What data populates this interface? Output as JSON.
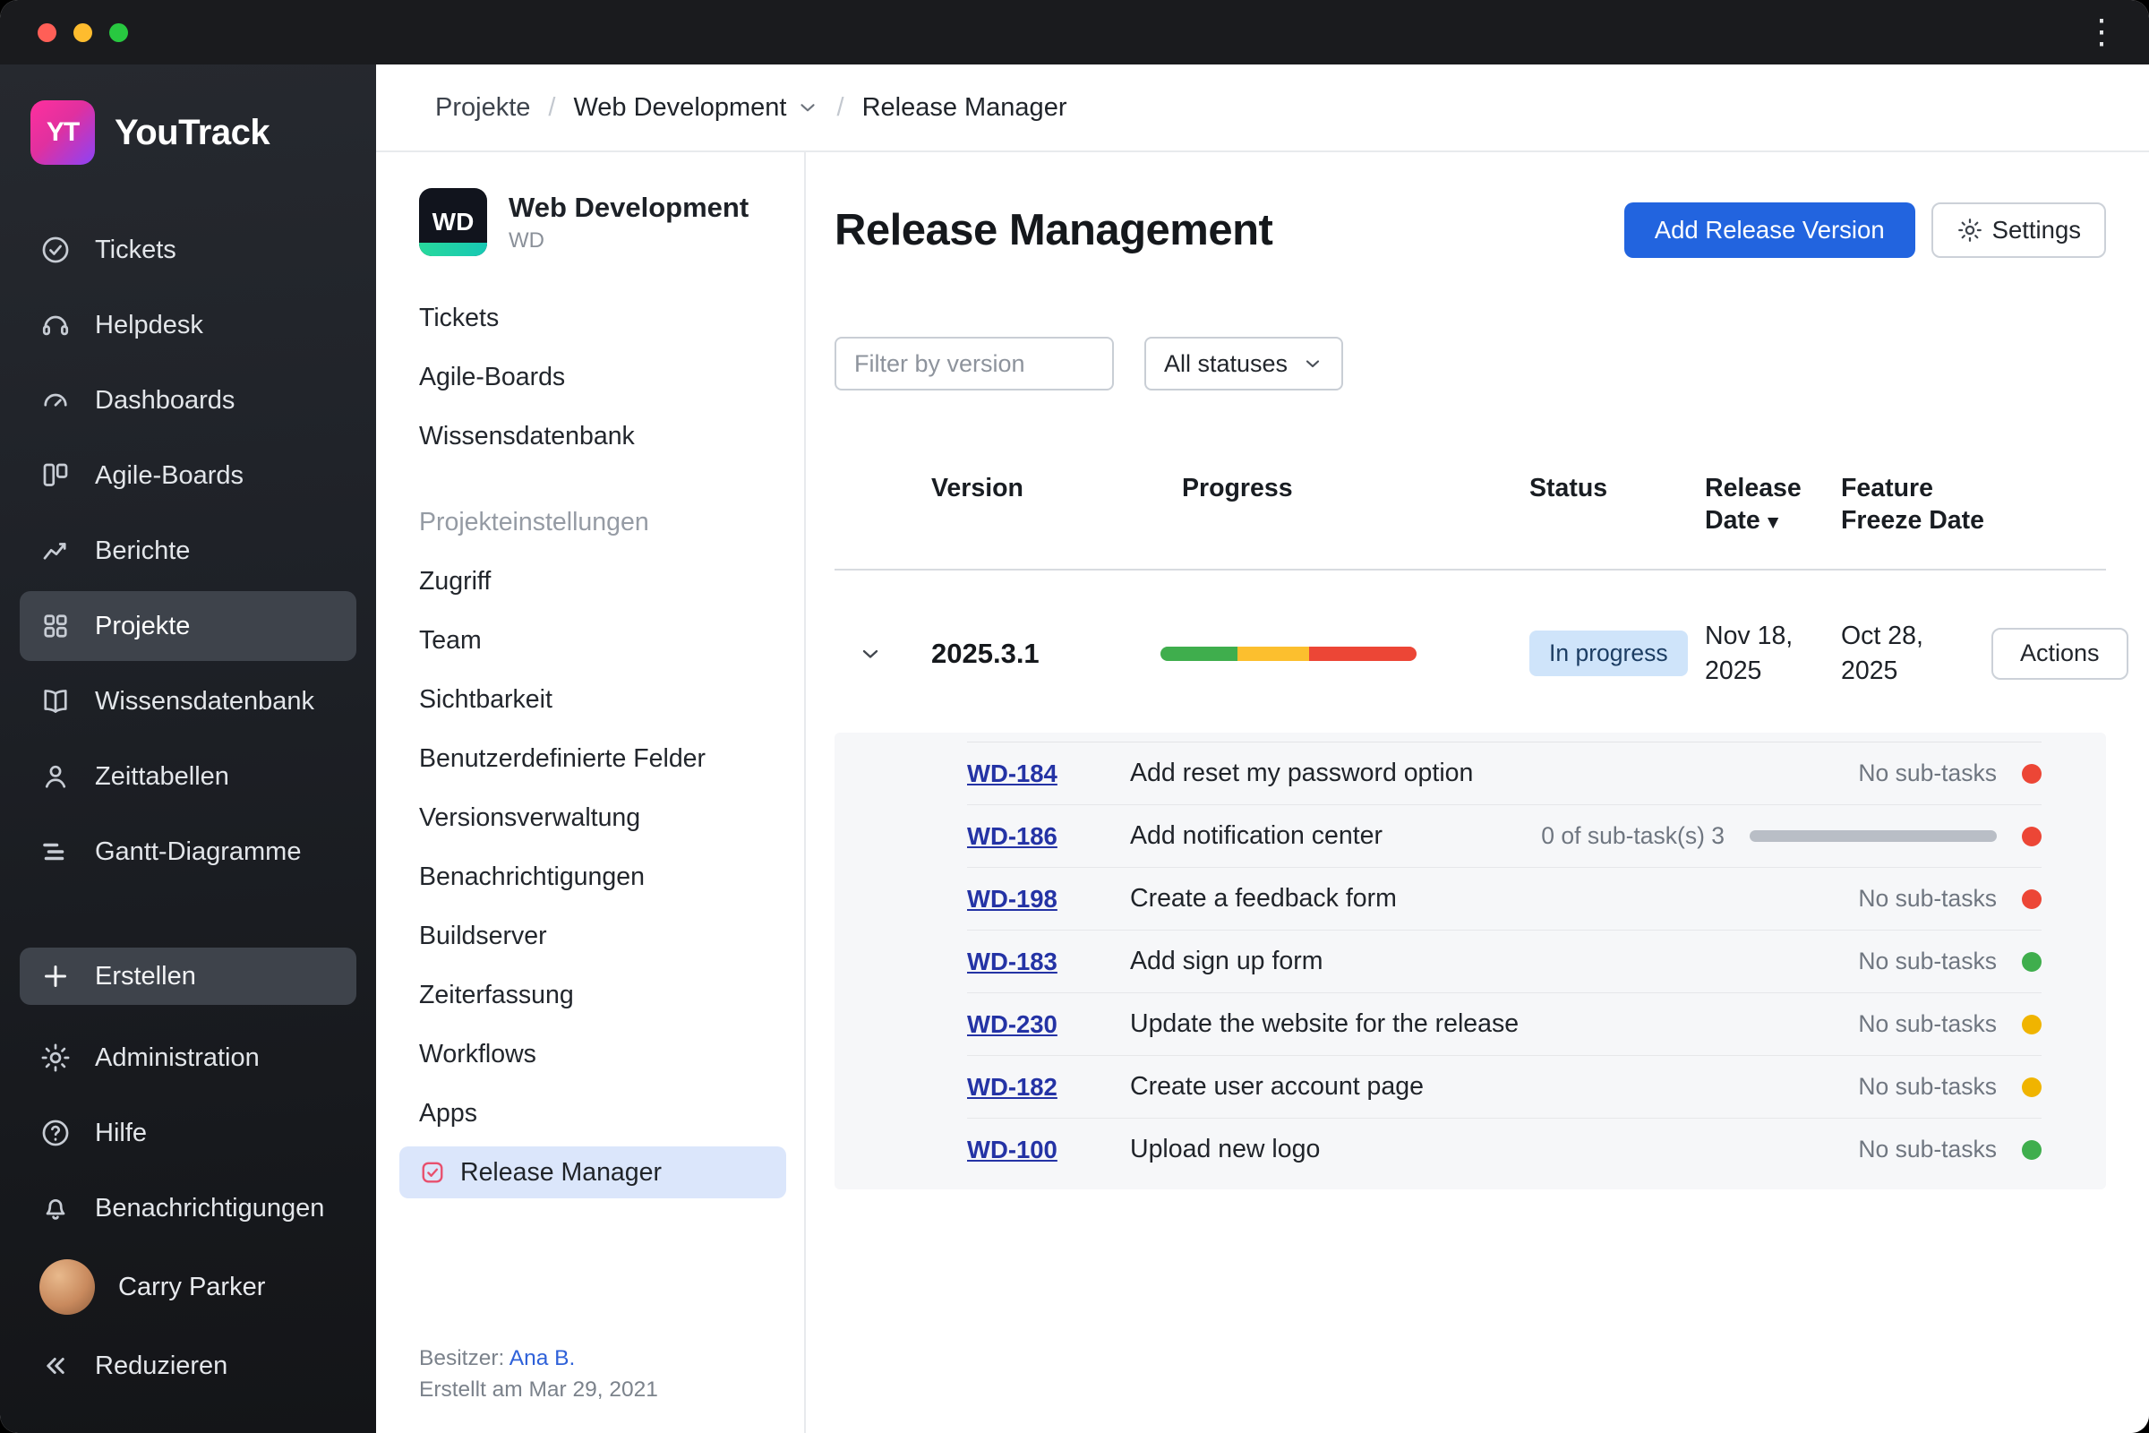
{
  "window": {
    "kebab_icon": "⋮",
    "traffic_lights": [
      "#ff5f57",
      "#febc2e",
      "#28c840"
    ]
  },
  "brand": {
    "logo_text": "YT",
    "app_name": "YouTrack"
  },
  "sidebar": {
    "items": [
      {
        "label": "Tickets"
      },
      {
        "label": "Helpdesk"
      },
      {
        "label": "Dashboards"
      },
      {
        "label": "Agile-Boards"
      },
      {
        "label": "Berichte"
      },
      {
        "label": "Projekte"
      },
      {
        "label": "Wissensdatenbank"
      },
      {
        "label": "Zeittabellen"
      },
      {
        "label": "Gantt-Diagramme"
      }
    ],
    "create_label": "Erstellen",
    "bottom_items": [
      {
        "label": "Administration"
      },
      {
        "label": "Hilfe"
      },
      {
        "label": "Benachrichtigungen"
      }
    ],
    "user_name": "Carry Parker",
    "collapse_label": "Reduzieren"
  },
  "breadcrumb": {
    "items": [
      "Projekte",
      "Web Development",
      "Release Manager"
    ],
    "separator": "/"
  },
  "project_panel": {
    "avatar_text": "WD",
    "name": "Web Development",
    "key": "WD",
    "items": [
      "Tickets",
      "Agile-Boards",
      "Wissensdatenbank"
    ],
    "section_label": "Projekteinstellungen",
    "settings_items": [
      "Zugriff",
      "Team",
      "Sichtbarkeit",
      "Benutzerdefinierte Felder",
      "Versionsverwaltung",
      "Benachrichtigungen",
      "Buildserver",
      "Zeiterfassung",
      "Workflows",
      "Apps"
    ],
    "selected_item": "Release Manager",
    "owner_label": "Besitzer:",
    "owner_name": "Ana B.",
    "created_text": "Erstellt am Mar 29, 2021"
  },
  "main": {
    "title": "Release Management",
    "add_button_label": "Add Release Version",
    "settings_button_label": "Settings",
    "filter_placeholder": "Filter by version",
    "status_filter_value": "All statuses",
    "table": {
      "headers": {
        "version": "Version",
        "progress": "Progress",
        "status": "Status",
        "release_date": "Release Date",
        "freeze_date": "Feature Freeze Date",
        "sort_arrow": "▼"
      },
      "release": {
        "version": "2025.3.1",
        "progress_segments": [
          {
            "color": "#3fae4d",
            "width": "30%"
          },
          {
            "color": "#fcbf2e",
            "width": "28%"
          },
          {
            "color": "#ec4636",
            "width": "42%"
          }
        ],
        "status": "In progress",
        "release_date": "Nov 18, 2025",
        "freeze_date": "Oct 28, 2025",
        "actions_label": "Actions"
      },
      "subtasks": [
        {
          "id": "WD-184",
          "summary": "Add reset my password option",
          "meta": "No sub-tasks",
          "dot": "red",
          "dot_color": "#ec4636"
        },
        {
          "id": "WD-186",
          "summary": "Add notification center",
          "meta": "0 of sub-task(s) 3",
          "dot": "red",
          "dot_color": "#ec4636",
          "bar_color": "#b9bec6"
        },
        {
          "id": "WD-198",
          "summary": "Create a feedback form",
          "meta": "No sub-tasks",
          "dot": "red",
          "dot_color": "#ec4636"
        },
        {
          "id": "WD-183",
          "summary": "Add sign up form",
          "meta": "No sub-tasks",
          "dot": "green",
          "dot_color": "#3fae4d"
        },
        {
          "id": "WD-230",
          "summary": "Update the website for the release",
          "meta": "No sub-tasks",
          "dot": "yellow",
          "dot_color": "#f0b400"
        },
        {
          "id": "WD-182",
          "summary": "Create user account page",
          "meta": "No sub-tasks",
          "dot": "yellow",
          "dot_color": "#f0b400"
        },
        {
          "id": "WD-100",
          "summary": "Upload new logo",
          "meta": "No sub-tasks",
          "dot": "green",
          "dot_color": "#3fae4d"
        }
      ]
    }
  },
  "colors": {
    "accent_blue": "#2264df",
    "badge_bg": "#cfe4fa",
    "badge_text": "#1c3d63",
    "red": "#ec4636",
    "green": "#3fae4d",
    "yellow": "#f0b400",
    "link_blue": "#2433a5",
    "owner_link_blue": "#2e61d9"
  }
}
